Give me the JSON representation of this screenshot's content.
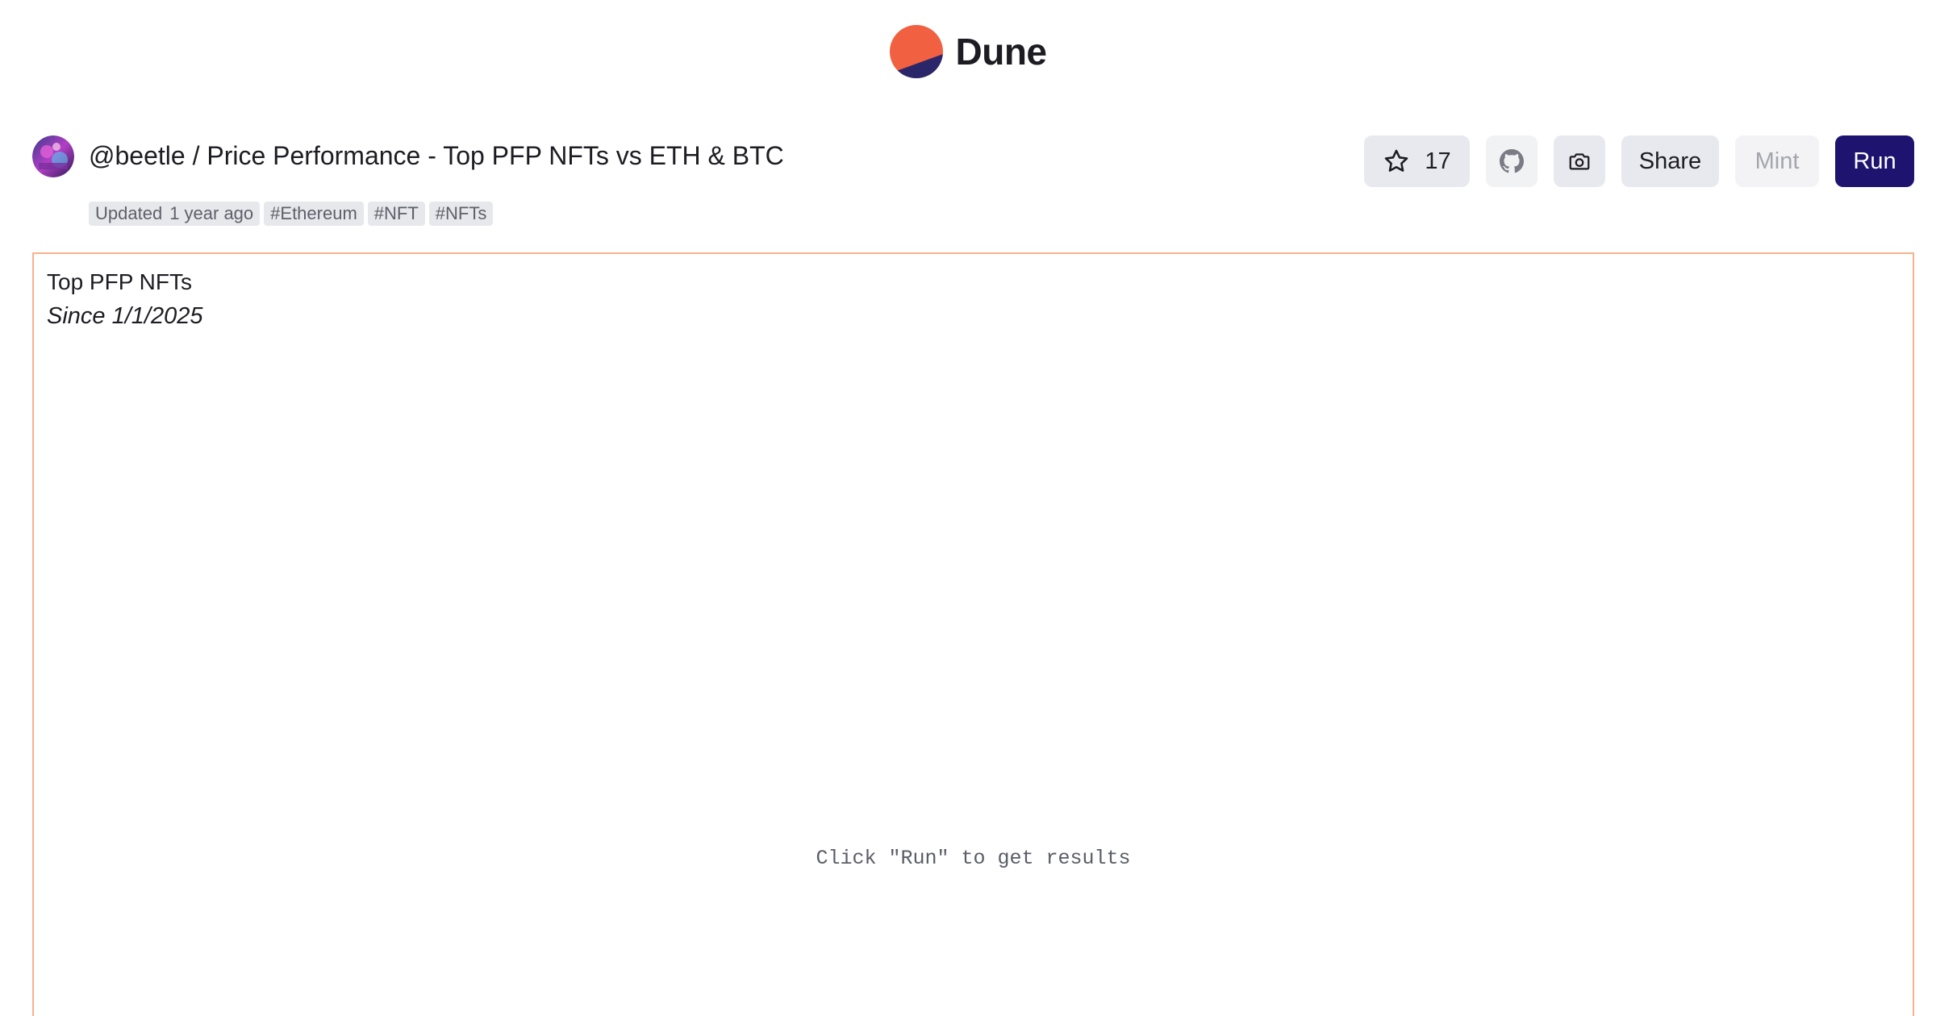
{
  "brand": {
    "name": "Dune",
    "logo_colors": {
      "top": "#f06041",
      "bottom": "#2b2669"
    }
  },
  "query": {
    "owner": "@beetle",
    "separator": "/",
    "title": "@beetle / Price Performance - Top PFP NFTs vs ETH & BTC",
    "updated_label": "Updated",
    "updated_value": "1 year ago",
    "tags": [
      "#Ethereum",
      "#NFT",
      "#NFTs"
    ]
  },
  "actions": {
    "star_icon": "star-icon",
    "star_count": "17",
    "github_icon": "github-icon",
    "camera_icon": "camera-icon",
    "share_label": "Share",
    "mint_label": "Mint",
    "run_label": "Run"
  },
  "visualization": {
    "title": "Top PFP NFTs",
    "subtitle": "Since 1/1/2025",
    "empty_message": "Click \"Run\" to get results",
    "border_color": "#f5b38c"
  },
  "colors": {
    "run_button": "#1e1470",
    "secondary_button": "#e8e9ee",
    "tag_background": "#e7e8ec"
  }
}
